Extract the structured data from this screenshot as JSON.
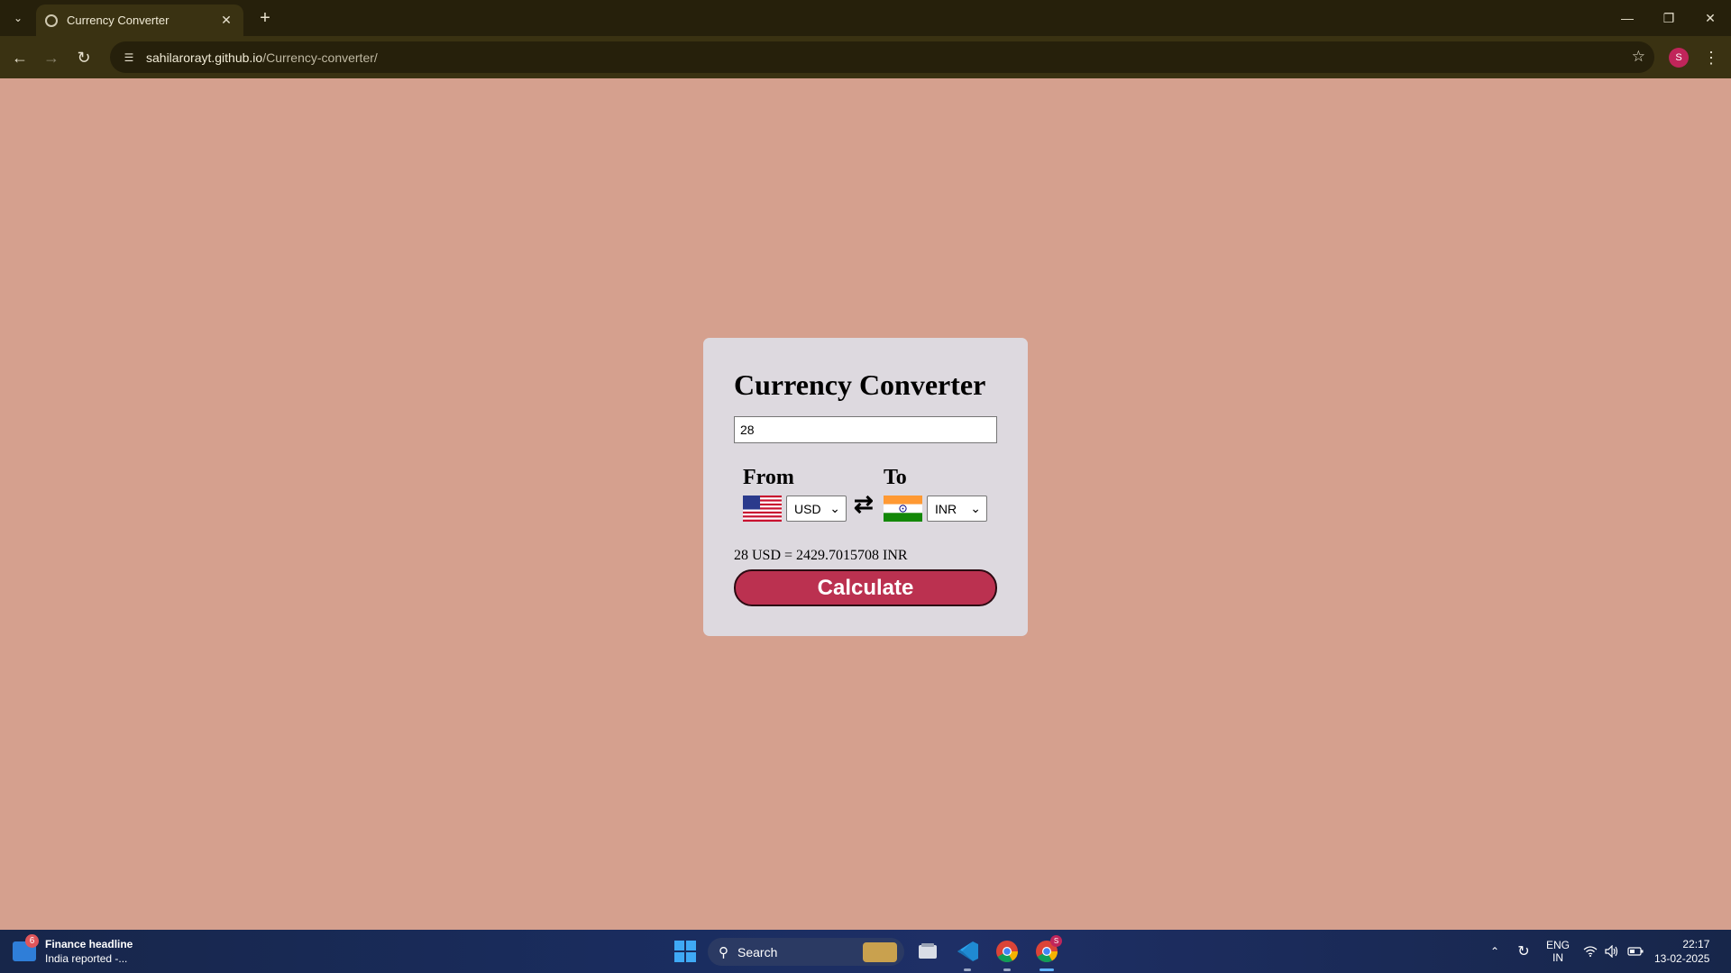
{
  "browser": {
    "tab_title": "Currency Converter",
    "url_host": "sahilarorayt.github.io",
    "url_path": "/Currency-converter/",
    "profile_initial": "S"
  },
  "page": {
    "title": "Currency Converter",
    "amount_value": "28",
    "from_label": "From",
    "to_label": "To",
    "from_currency": "USD",
    "to_currency": "INR",
    "result_message": "28 USD = 2429.7015708 INR",
    "calculate_label": "Calculate"
  },
  "taskbar": {
    "widget_badge": "6",
    "widget_title": "Finance headline",
    "widget_subtitle": "India reported -...",
    "search_label": "Search",
    "chrome_badge": "S",
    "lang_line1": "ENG",
    "lang_line2": "IN",
    "time": "22:17",
    "date": "13-02-2025"
  },
  "colors": {
    "page_background": "#d5a08e",
    "card_background": "#ddd9df",
    "button_color": "#bb3150",
    "browser_frame": "#26200b"
  },
  "icons": [
    "tab-list-icon",
    "globe-icon",
    "close-icon",
    "plus-icon",
    "minimize-icon",
    "restore-icon",
    "back-arrow-icon",
    "forward-arrow-icon",
    "reload-icon",
    "site-info-icon",
    "star-icon",
    "kebab-menu-icon",
    "us-flag-icon",
    "india-flag-icon",
    "swap-arrows-icon",
    "windows-logo-icon",
    "search-icon",
    "file-explorer-icon",
    "vscode-icon",
    "chrome-icon",
    "chevron-up-icon",
    "sync-icon",
    "wifi-icon",
    "volume-icon",
    "battery-icon"
  ]
}
